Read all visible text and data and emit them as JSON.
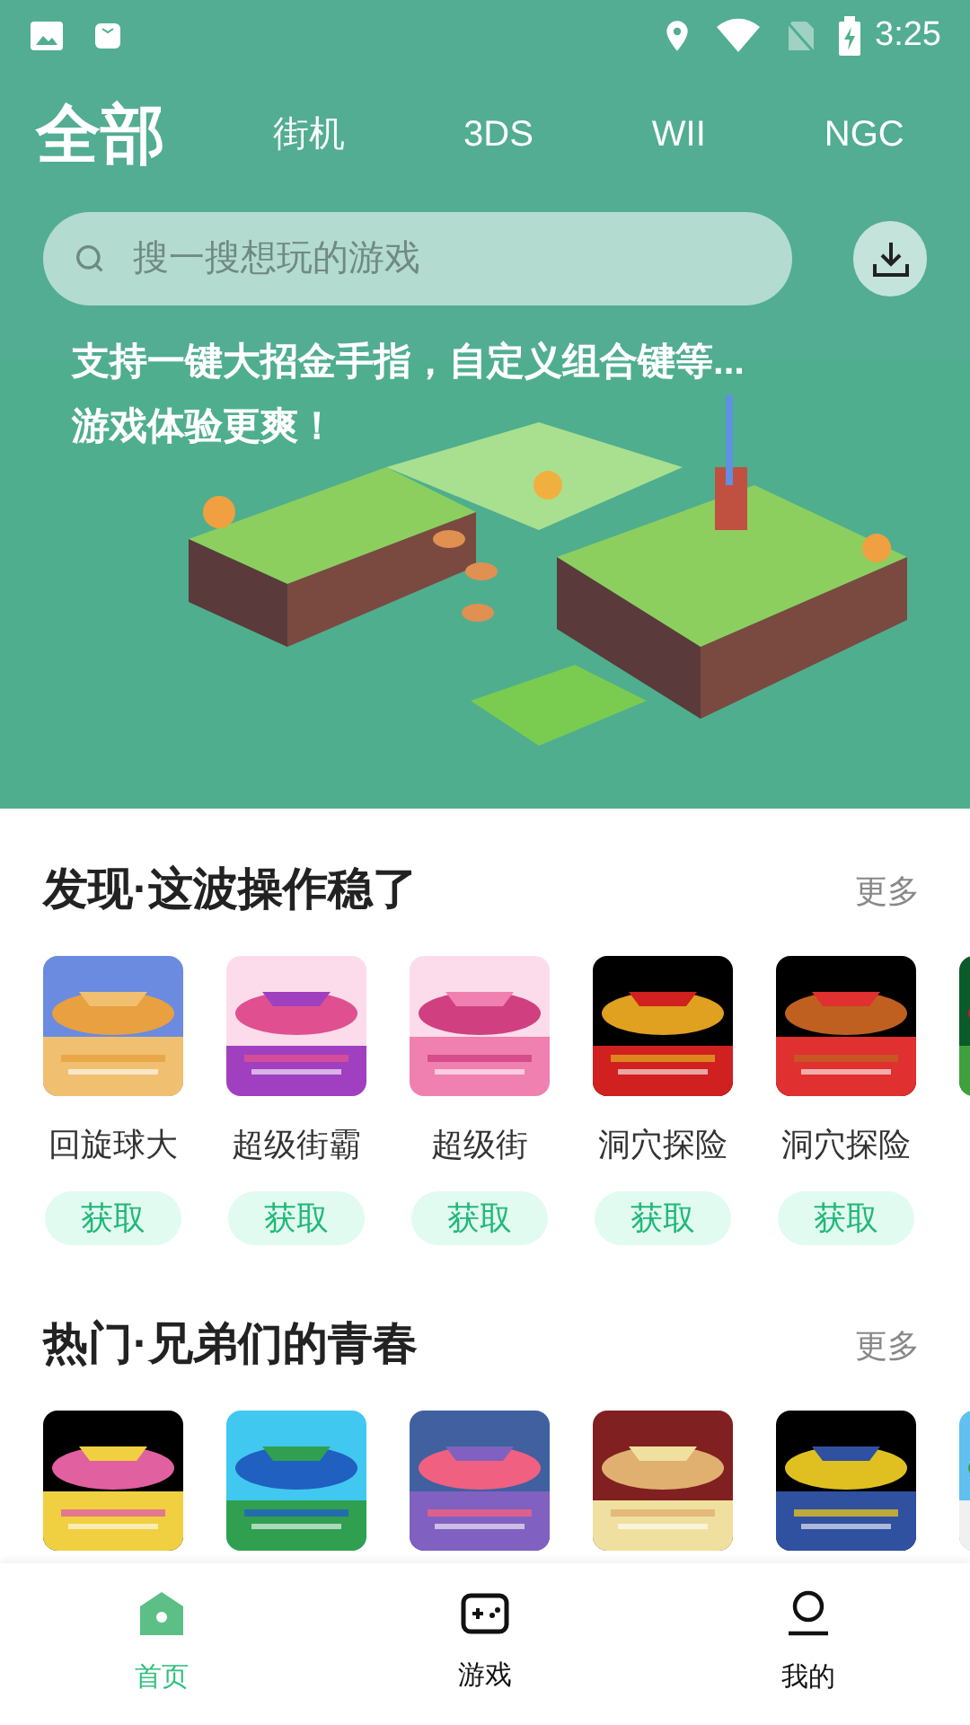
{
  "status_bar": {
    "time": "3:25"
  },
  "tabs": [
    {
      "label": "全部",
      "selected": true
    },
    {
      "label": "街机",
      "selected": false
    },
    {
      "label": "3DS",
      "selected": false
    },
    {
      "label": "WII",
      "selected": false
    },
    {
      "label": "NGC",
      "selected": false
    }
  ],
  "search": {
    "placeholder": "搜一搜想玩的游戏"
  },
  "banner": {
    "kind": "picture",
    "lines": [
      "支持一键大招金手指，自定义组合键等...",
      "游戏体验更爽！"
    ]
  },
  "sections": [
    {
      "title": "发现·这波操作稳了",
      "more": "更多",
      "games": [
        {
          "kind": "picture",
          "title": "回旋球大",
          "button": "获取"
        },
        {
          "kind": "picture",
          "title": "超级街霸",
          "button": "获取"
        },
        {
          "kind": "picture",
          "title": "超级街",
          "button": "获取"
        },
        {
          "kind": "picture",
          "title": "洞穴探险",
          "button": "获取"
        },
        {
          "kind": "picture",
          "title": "洞穴探险",
          "button": "获取"
        },
        {
          "kind": "picture"
        }
      ]
    },
    {
      "title": "热门·兄弟们的青春",
      "more": "更多",
      "games": [
        {
          "kind": "picture"
        },
        {
          "kind": "picture"
        },
        {
          "kind": "picture"
        },
        {
          "kind": "picture"
        },
        {
          "kind": "picture"
        },
        {
          "kind": "picture"
        }
      ]
    }
  ],
  "bottom_nav": [
    {
      "label": "首页",
      "selected": true
    },
    {
      "label": "游戏",
      "selected": false
    },
    {
      "label": "我的",
      "selected": false
    }
  ]
}
